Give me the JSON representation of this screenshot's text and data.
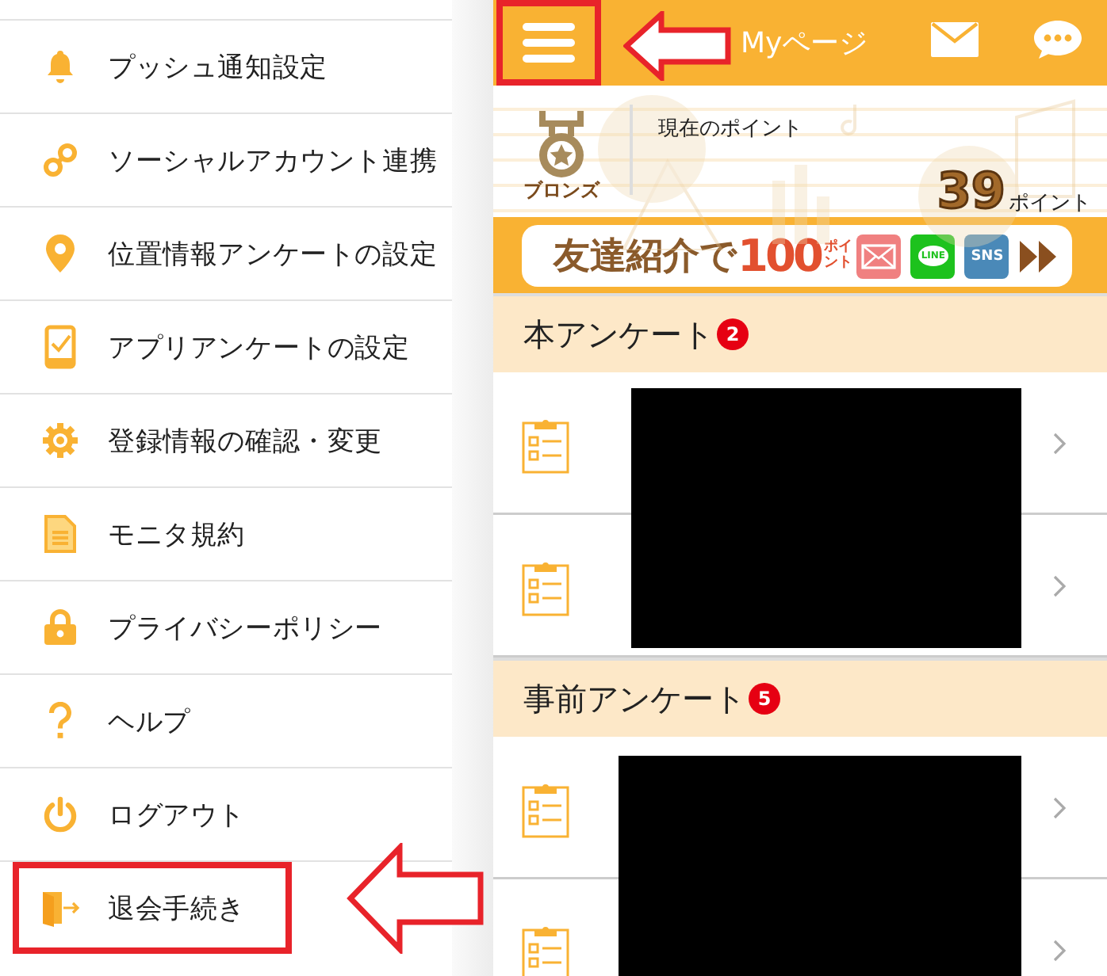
{
  "menu": {
    "items": [
      {
        "label": "プッシュ通知設定",
        "highlighted": false
      },
      {
        "label": "ソーシャルアカウント連携",
        "highlighted": false
      },
      {
        "label": "位置情報アンケートの設定",
        "highlighted": false
      },
      {
        "label": "アプリアンケートの設定",
        "highlighted": false
      },
      {
        "label": "登録情報の確認・変更",
        "highlighted": false
      },
      {
        "label": "モニタ規約",
        "highlighted": false
      },
      {
        "label": "プライバシーポリシー",
        "highlighted": false
      },
      {
        "label": "ヘルプ",
        "highlighted": false
      },
      {
        "label": "ログアウト",
        "highlighted": false
      },
      {
        "label": "退会手続き",
        "highlighted": true
      }
    ]
  },
  "header": {
    "title": "Myページ",
    "menu_highlighted": true
  },
  "points": {
    "rank": "ブロンズ",
    "caption": "現在のポイント",
    "value": "39",
    "unit": "ポイント"
  },
  "banner": {
    "text": "友達紹介で",
    "amount": "100",
    "unit_top": "ポイ",
    "unit_bottom": "ント",
    "line_label": "LINE",
    "sns_label": "SNS"
  },
  "sections": [
    {
      "title": "本アンケート",
      "badge": "2",
      "rows": [
        {
          "redacted": true
        },
        {
          "redacted": true
        }
      ]
    },
    {
      "title": "事前アンケート",
      "badge": "5",
      "rows": [
        {
          "redacted": true
        },
        {
          "redacted": true
        }
      ]
    }
  ]
}
